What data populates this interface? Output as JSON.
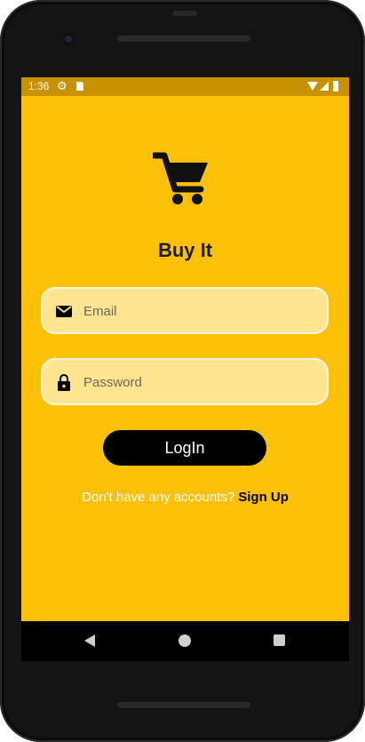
{
  "statusbar": {
    "time": "1:36",
    "icons": [
      "gear-icon",
      "sd-card-icon",
      "wifi-icon",
      "signal-icon",
      "battery-icon"
    ]
  },
  "app": {
    "title": "Buy It",
    "logo_icon": "shopping-cart-icon",
    "accent_color": "#ffc107",
    "statusbar_color": "#c79100"
  },
  "email": {
    "placeholder": "Email",
    "value": "",
    "icon": "mail-icon"
  },
  "password": {
    "placeholder": "Password",
    "value": "",
    "icon": "lock-icon"
  },
  "login": {
    "label": "LogIn"
  },
  "signup": {
    "prompt": "Don't have any accounts?",
    "link": "Sign Up"
  },
  "navbar": {
    "buttons": [
      "back-icon",
      "home-icon",
      "recents-icon"
    ]
  }
}
